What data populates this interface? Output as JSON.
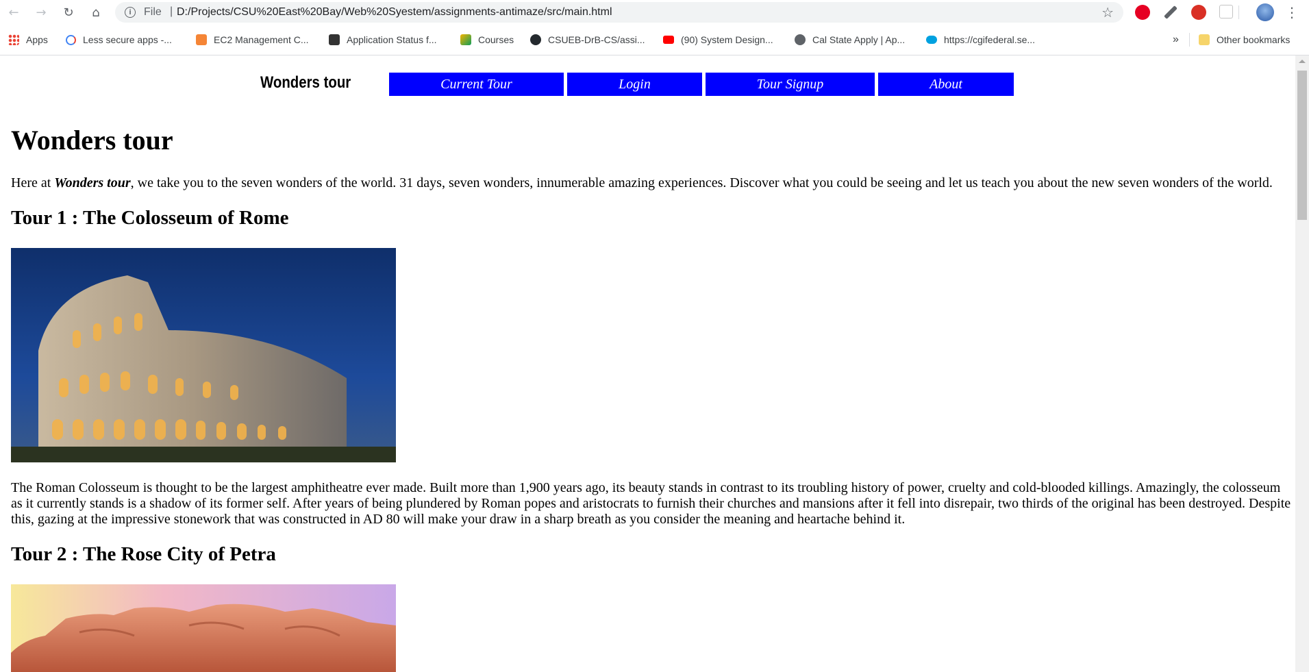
{
  "browser": {
    "url_scheme": "File",
    "url": "D:/Projects/CSU%20East%20Bay/Web%20Syestem/assignments-antimaze/src/main.html",
    "bookmarks": [
      {
        "label": "Apps",
        "icon": "apps-grid-icon"
      },
      {
        "label": "Less secure apps -...",
        "icon": "google-icon"
      },
      {
        "label": "EC2 Management C...",
        "icon": "aws-cube-icon"
      },
      {
        "label": "Application Status f...",
        "icon": "status-logo-icon"
      },
      {
        "label": "Courses",
        "icon": "courses-icon"
      },
      {
        "label": "CSUEB-DrB-CS/assi...",
        "icon": "github-icon"
      },
      {
        "label": "(90) System Design...",
        "icon": "youtube-icon"
      },
      {
        "label": "Cal State Apply | Ap...",
        "icon": "globe-icon"
      },
      {
        "label": "https://cgifederal.se...",
        "icon": "salesforce-cloud-icon"
      }
    ],
    "overflow_label": "»",
    "other_bookmarks": "Other bookmarks"
  },
  "site": {
    "brand": "Wonders tour",
    "nav": [
      "Current Tour",
      "Login",
      "Tour Signup",
      "About"
    ]
  },
  "main": {
    "heading": "Wonders tour",
    "intro_before": "Here at ",
    "intro_brand": "Wonders tour",
    "intro_after": ", we take you to the seven wonders of the world. 31 days, seven wonders, innumerable amazing experiences. Discover what you could be seeing and let us teach you about the new seven wonders of the world.",
    "tours": [
      {
        "title": "Tour 1 : The Colosseum of Rome",
        "image_alt": "Colosseum at dusk",
        "description": "The Roman Colosseum is thought to be the largest amphitheatre ever made. Built more than 1,900 years ago, its beauty stands in contrast to its troubling history of power, cruelty and cold-blooded killings. Amazingly, the colosseum as it currently stands is a shadow of its former self. After years of being plundered by Roman popes and aristocrats to furnish their churches and mansions after it fell into disrepair, two thirds of the original has been destroyed. Despite this, gazing at the impressive stonework that was constructed in AD 80 will make your draw in a sharp breath as you consider the meaning and heartache behind it."
      },
      {
        "title": "Tour 2 : The Rose City of Petra",
        "image_alt": "Petra rose-colored cliffs"
      }
    ]
  },
  "colors": {
    "nav_bg": "#0000ff",
    "nav_text": "#ffffff"
  }
}
